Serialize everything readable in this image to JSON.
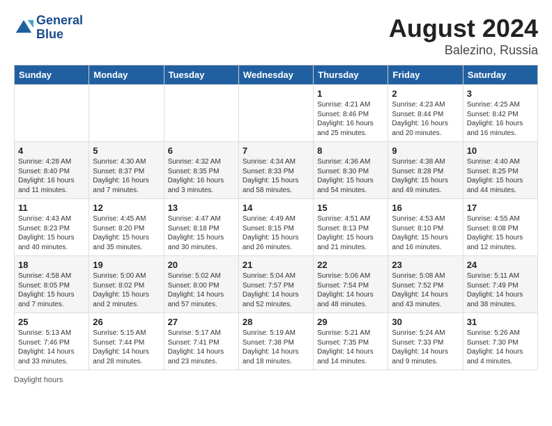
{
  "logo": {
    "line1": "General",
    "line2": "Blue"
  },
  "title": "August 2024",
  "subtitle": "Balezino, Russia",
  "days_of_week": [
    "Sunday",
    "Monday",
    "Tuesday",
    "Wednesday",
    "Thursday",
    "Friday",
    "Saturday"
  ],
  "weeks": [
    [
      {
        "num": "",
        "info": ""
      },
      {
        "num": "",
        "info": ""
      },
      {
        "num": "",
        "info": ""
      },
      {
        "num": "",
        "info": ""
      },
      {
        "num": "1",
        "info": "Sunrise: 4:21 AM\nSunset: 8:46 PM\nDaylight: 16 hours\nand 25 minutes."
      },
      {
        "num": "2",
        "info": "Sunrise: 4:23 AM\nSunset: 8:44 PM\nDaylight: 16 hours\nand 20 minutes."
      },
      {
        "num": "3",
        "info": "Sunrise: 4:25 AM\nSunset: 8:42 PM\nDaylight: 16 hours\nand 16 minutes."
      }
    ],
    [
      {
        "num": "4",
        "info": "Sunrise: 4:28 AM\nSunset: 8:40 PM\nDaylight: 16 hours\nand 11 minutes."
      },
      {
        "num": "5",
        "info": "Sunrise: 4:30 AM\nSunset: 8:37 PM\nDaylight: 16 hours\nand 7 minutes."
      },
      {
        "num": "6",
        "info": "Sunrise: 4:32 AM\nSunset: 8:35 PM\nDaylight: 16 hours\nand 3 minutes."
      },
      {
        "num": "7",
        "info": "Sunrise: 4:34 AM\nSunset: 8:33 PM\nDaylight: 15 hours\nand 58 minutes."
      },
      {
        "num": "8",
        "info": "Sunrise: 4:36 AM\nSunset: 8:30 PM\nDaylight: 15 hours\nand 54 minutes."
      },
      {
        "num": "9",
        "info": "Sunrise: 4:38 AM\nSunset: 8:28 PM\nDaylight: 15 hours\nand 49 minutes."
      },
      {
        "num": "10",
        "info": "Sunrise: 4:40 AM\nSunset: 8:25 PM\nDaylight: 15 hours\nand 44 minutes."
      }
    ],
    [
      {
        "num": "11",
        "info": "Sunrise: 4:43 AM\nSunset: 8:23 PM\nDaylight: 15 hours\nand 40 minutes."
      },
      {
        "num": "12",
        "info": "Sunrise: 4:45 AM\nSunset: 8:20 PM\nDaylight: 15 hours\nand 35 minutes."
      },
      {
        "num": "13",
        "info": "Sunrise: 4:47 AM\nSunset: 8:18 PM\nDaylight: 15 hours\nand 30 minutes."
      },
      {
        "num": "14",
        "info": "Sunrise: 4:49 AM\nSunset: 8:15 PM\nDaylight: 15 hours\nand 26 minutes."
      },
      {
        "num": "15",
        "info": "Sunrise: 4:51 AM\nSunset: 8:13 PM\nDaylight: 15 hours\nand 21 minutes."
      },
      {
        "num": "16",
        "info": "Sunrise: 4:53 AM\nSunset: 8:10 PM\nDaylight: 15 hours\nand 16 minutes."
      },
      {
        "num": "17",
        "info": "Sunrise: 4:55 AM\nSunset: 8:08 PM\nDaylight: 15 hours\nand 12 minutes."
      }
    ],
    [
      {
        "num": "18",
        "info": "Sunrise: 4:58 AM\nSunset: 8:05 PM\nDaylight: 15 hours\nand 7 minutes."
      },
      {
        "num": "19",
        "info": "Sunrise: 5:00 AM\nSunset: 8:02 PM\nDaylight: 15 hours\nand 2 minutes."
      },
      {
        "num": "20",
        "info": "Sunrise: 5:02 AM\nSunset: 8:00 PM\nDaylight: 14 hours\nand 57 minutes."
      },
      {
        "num": "21",
        "info": "Sunrise: 5:04 AM\nSunset: 7:57 PM\nDaylight: 14 hours\nand 52 minutes."
      },
      {
        "num": "22",
        "info": "Sunrise: 5:06 AM\nSunset: 7:54 PM\nDaylight: 14 hours\nand 48 minutes."
      },
      {
        "num": "23",
        "info": "Sunrise: 5:08 AM\nSunset: 7:52 PM\nDaylight: 14 hours\nand 43 minutes."
      },
      {
        "num": "24",
        "info": "Sunrise: 5:11 AM\nSunset: 7:49 PM\nDaylight: 14 hours\nand 38 minutes."
      }
    ],
    [
      {
        "num": "25",
        "info": "Sunrise: 5:13 AM\nSunset: 7:46 PM\nDaylight: 14 hours\nand 33 minutes."
      },
      {
        "num": "26",
        "info": "Sunrise: 5:15 AM\nSunset: 7:44 PM\nDaylight: 14 hours\nand 28 minutes."
      },
      {
        "num": "27",
        "info": "Sunrise: 5:17 AM\nSunset: 7:41 PM\nDaylight: 14 hours\nand 23 minutes."
      },
      {
        "num": "28",
        "info": "Sunrise: 5:19 AM\nSunset: 7:38 PM\nDaylight: 14 hours\nand 18 minutes."
      },
      {
        "num": "29",
        "info": "Sunrise: 5:21 AM\nSunset: 7:35 PM\nDaylight: 14 hours\nand 14 minutes."
      },
      {
        "num": "30",
        "info": "Sunrise: 5:24 AM\nSunset: 7:33 PM\nDaylight: 14 hours\nand 9 minutes."
      },
      {
        "num": "31",
        "info": "Sunrise: 5:26 AM\nSunset: 7:30 PM\nDaylight: 14 hours\nand 4 minutes."
      }
    ]
  ],
  "footer": "Daylight hours"
}
